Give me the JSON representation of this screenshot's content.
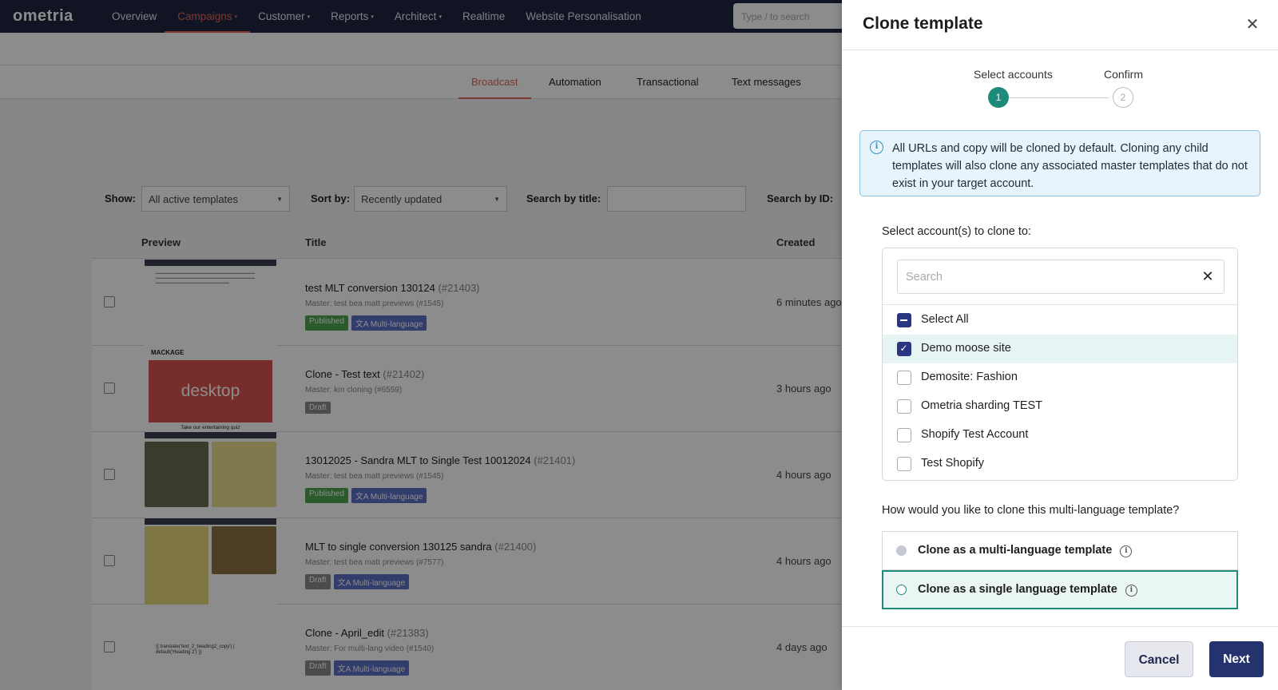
{
  "app": {
    "logo": "ometria",
    "nav": [
      {
        "label": "Overview",
        "caret": ""
      },
      {
        "label": "Campaigns",
        "caret": "▾"
      },
      {
        "label": "Customer",
        "caret": "▾"
      },
      {
        "label": "Reports",
        "caret": "▾"
      },
      {
        "label": "Architect",
        "caret": "▾"
      },
      {
        "label": "Realtime",
        "caret": ""
      },
      {
        "label": "Website Personalisation",
        "caret": ""
      }
    ],
    "search_placeholder": "Type / to search",
    "tabs": [
      "Broadcast",
      "Automation",
      "Transactional",
      "Text messages"
    ],
    "filters": {
      "show_label": "Show:",
      "show_value": "All active templates",
      "sort_label": "Sort by:",
      "sort_value": "Recently updated",
      "title_label": "Search by title:",
      "id_label": "Search by ID:"
    },
    "table": {
      "headers": {
        "preview": "Preview",
        "title": "Title",
        "created": "Created"
      },
      "rows": [
        {
          "title": "test MLT conversion 130124",
          "id": "(#21403)",
          "master": "Master: test bea matt previews (#1545)",
          "status": "Published",
          "multi": "Multi-language",
          "created": "6 minutes ago"
        },
        {
          "title": "Clone - Test text",
          "id": "(#21402)",
          "master": "Master: km cloning (#6559)",
          "status": "Draft",
          "multi": "",
          "created": "3 hours ago",
          "thumb_text": "desktop",
          "thumb_brand": "MACKAGE",
          "thumb_caption": "Take our entertaining quiz"
        },
        {
          "title": "13012025 - Sandra MLT to Single Test 10012024",
          "id": "(#21401)",
          "master": "Master: test bea matt previews (#1545)",
          "status": "Published",
          "multi": "Multi-language",
          "created": "4 hours ago"
        },
        {
          "title": "MLT to single conversion 130125 sandra",
          "id": "(#21400)",
          "master": "Master: test bea matt previews (#7577)",
          "status": "Draft",
          "multi": "Multi-language",
          "created": "4 hours ago"
        },
        {
          "title": "Clone - April_edit",
          "id": "(#21383)",
          "master": "Master: For multi-lang video (#1540)",
          "status": "Draft",
          "multi": "Multi-language",
          "created": "4 days ago",
          "thumb_text": "{{ translate('text_2_heading2_copy') | default('Heading 2') }}"
        }
      ]
    }
  },
  "drawer": {
    "title": "Clone template",
    "close_icon": "close-icon",
    "steps": [
      {
        "label": "Select accounts",
        "number": "1",
        "active": true
      },
      {
        "label": "Confirm",
        "number": "2",
        "active": false
      }
    ],
    "info": "All URLs and copy will be cloned by default. Cloning any child templates will also clone any associated master templates that do not exist in your target account.",
    "select_label": "Select account(s) to clone to:",
    "search_placeholder": "Search",
    "accounts": [
      {
        "name": "Select All",
        "state": "indeterminate"
      },
      {
        "name": "Demo moose site",
        "state": "checked"
      },
      {
        "name": "Demosite: Fashion",
        "state": "unchecked"
      },
      {
        "name": "Ometria sharding TEST",
        "state": "unchecked"
      },
      {
        "name": "Shopify Test Account",
        "state": "unchecked"
      },
      {
        "name": "Test Shopify",
        "state": "unchecked"
      }
    ],
    "ml_question": "How would you like to clone this multi-language template?",
    "options": [
      {
        "label": "Clone as a multi-language template",
        "selected": false
      },
      {
        "label": "Clone as a single language template",
        "selected": true
      }
    ],
    "cancel_label": "Cancel",
    "next_label": "Next"
  },
  "colors": {
    "nav_bg": "#1f2540",
    "accent_red": "#e2675a",
    "teal": "#1d8a7a",
    "primary": "#24336d"
  }
}
